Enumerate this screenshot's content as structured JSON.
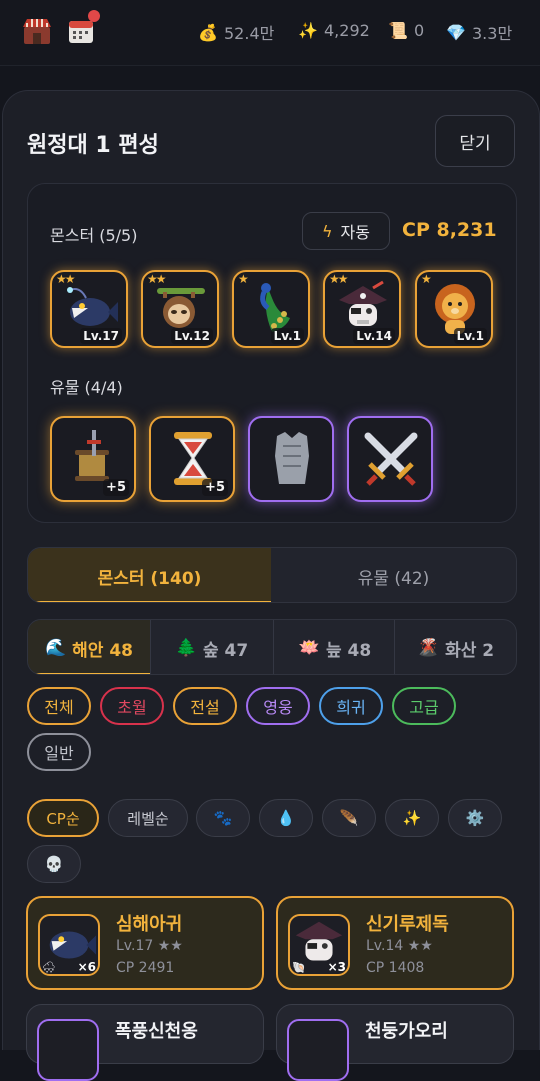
{
  "topbar": {
    "resources": [
      {
        "icon": "money-bag-icon",
        "value": "52.4만"
      },
      {
        "icon": "sparkle-icon",
        "value": "4,292"
      },
      {
        "icon": "scroll-icon",
        "value": "0"
      },
      {
        "icon": "gem-icon",
        "value": "3.3만"
      }
    ]
  },
  "panel": {
    "title": "원정대 1 편성",
    "close_label": "닫기"
  },
  "party": {
    "monster_label": "몬스터 (5/5)",
    "auto_label": "자동",
    "cp_label": "CP 8,231",
    "monsters": [
      {
        "stars": "★★",
        "level": "Lv.17"
      },
      {
        "stars": "★★",
        "level": "Lv.12"
      },
      {
        "stars": "★",
        "level": "Lv.1"
      },
      {
        "stars": "★★",
        "level": "Lv.14"
      },
      {
        "stars": "★",
        "level": "Lv.1"
      }
    ],
    "relic_label": "유물 (4/4)",
    "relics": [
      {
        "plus": "+5"
      },
      {
        "plus": "+5"
      },
      {
        "plus": ""
      },
      {
        "plus": ""
      }
    ]
  },
  "tabs": {
    "monsters": "몬스터 (140)",
    "relics": "유물 (42)"
  },
  "biomes": [
    {
      "icon": "🌊",
      "label": "해안 48"
    },
    {
      "icon": "🌲",
      "label": "숲 47"
    },
    {
      "icon": "🪷",
      "label": "늪 48"
    },
    {
      "icon": "🌋",
      "label": "화산 2"
    }
  ],
  "rarity_filters": [
    {
      "label": "전체",
      "color": "#e9a237"
    },
    {
      "label": "초월",
      "color": "#d8324c"
    },
    {
      "label": "전설",
      "color": "#e9a237"
    },
    {
      "label": "영웅",
      "color": "#a06ef0"
    },
    {
      "label": "희귀",
      "color": "#4ea0ea"
    },
    {
      "label": "고급",
      "color": "#4cbb5c"
    },
    {
      "label": "일반",
      "color": "#8e909a"
    }
  ],
  "sort": {
    "cp": "CP순",
    "level": "레벨순",
    "icons": [
      "🐾",
      "💧",
      "🪶",
      "✨",
      "⚙️",
      "💀"
    ]
  },
  "cards": [
    {
      "name": "심해아귀",
      "level": "Lv.17",
      "stars": "★★",
      "cp": "CP 2491",
      "count": "×6",
      "weather": "🌨"
    },
    {
      "name": "신기루제독",
      "level": "Lv.14",
      "stars": "★★",
      "cp": "CP 1408",
      "count": "×3",
      "weather": "🐚"
    },
    {
      "name": "폭풍신천옹"
    },
    {
      "name": "천둥가오리"
    }
  ]
}
